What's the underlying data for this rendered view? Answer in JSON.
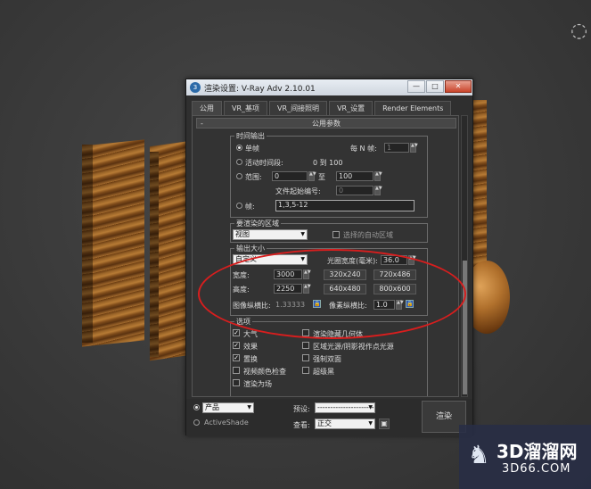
{
  "window": {
    "title": "渲染设置: V-Ray Adv 2.10.01",
    "app_icon": "3",
    "buttons": {
      "minimize": "—",
      "maximize": "□",
      "close": "✕"
    }
  },
  "tabs": [
    "公用",
    "VR_基项",
    "VR_间接照明",
    "VR_设置",
    "Render Elements"
  ],
  "rollout": {
    "collapse": "-",
    "title": "公用参数"
  },
  "time_output": {
    "label": "时间输出",
    "single": "单帧",
    "every_n_label": "每 N 帧:",
    "every_n_value": "1",
    "active_segment": "活动时间段:",
    "active_segment_value": "0 到 100",
    "range": "范围:",
    "range_from": "0",
    "range_to_label": "至",
    "range_to": "100",
    "file_number_label": "文件起始编号:",
    "file_number": "0",
    "frames": "帧:",
    "frames_value": "1,3,5-12"
  },
  "render_area": {
    "label": "要渲染的区域",
    "mode": "视图",
    "auto_region_label": "选择的自动区域"
  },
  "output_size": {
    "label": "输出大小",
    "preset": "自定义",
    "aperture_label": "光圈宽度(毫米):",
    "aperture_value": "36.0",
    "width_label": "宽度:",
    "width_value": "3000",
    "height_label": "高度:",
    "height_value": "2250",
    "sizes": [
      "320x240",
      "720x486",
      "640x480",
      "800x600"
    ],
    "image_aspect_label": "图像纵横比:",
    "image_aspect_value": "1.33333",
    "pixel_aspect_label": "像素纵横比:",
    "pixel_aspect_value": "1.0"
  },
  "options": {
    "label": "选项",
    "items": [
      {
        "label": "大气",
        "checked": true
      },
      {
        "label": "渲染隐藏几何体",
        "checked": false
      },
      {
        "label": "效果",
        "checked": true
      },
      {
        "label": "区域光源/阴影视作点光源",
        "checked": false
      },
      {
        "label": "置换",
        "checked": true
      },
      {
        "label": "强制双面",
        "checked": false
      },
      {
        "label": "视频颜色检查",
        "checked": false
      },
      {
        "label": "超级黑",
        "checked": false
      },
      {
        "label": "渲染为场",
        "checked": false
      }
    ]
  },
  "bottom": {
    "product_label": "产品",
    "activeshade_label": "ActiveShade",
    "preset_label": "预设:",
    "preset_value": "----------------------",
    "view_label": "查看:",
    "view_value": "正交",
    "render_label": "渲染"
  },
  "watermark": {
    "title": "3D溜溜网",
    "url": "3D66.COM"
  },
  "colors": {
    "highlight": "#d81e1e",
    "titlebar": "#dfe5ec",
    "panel": "#333333"
  }
}
